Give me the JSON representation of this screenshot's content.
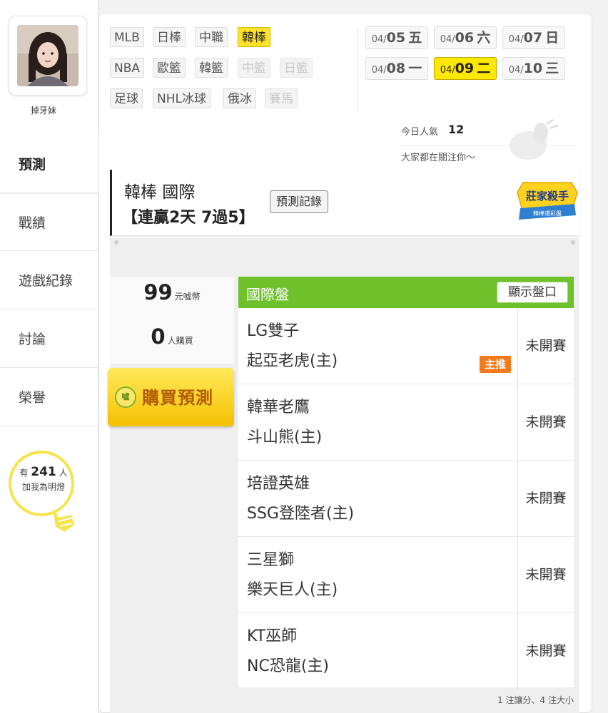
{
  "user": {
    "name": "掉牙妹"
  },
  "sidebar": {
    "items": [
      {
        "label": "預測",
        "active": true
      },
      {
        "label": "戰績"
      },
      {
        "label": "遊戲紀錄"
      },
      {
        "label": "討論"
      },
      {
        "label": "榮譽"
      }
    ],
    "fans": {
      "prefix": "有",
      "count": "241",
      "suffix": "人",
      "caption": "加我為明燈"
    }
  },
  "sports": [
    {
      "label": "MLB"
    },
    {
      "label": "日棒"
    },
    {
      "label": "中職"
    },
    {
      "label": "韓棒",
      "active": true
    },
    {
      "label": "NBA"
    },
    {
      "label": "歐籃"
    },
    {
      "label": "韓籃"
    },
    {
      "label": "中籃",
      "disabled": true
    },
    {
      "label": "日籃",
      "disabled": true
    },
    {
      "label": "足球"
    },
    {
      "label": "NHL冰球"
    },
    {
      "label": "俄冰"
    },
    {
      "label": "賽馬",
      "disabled": true
    }
  ],
  "dates": [
    {
      "month": "04/",
      "day": "05",
      "weekday": "五"
    },
    {
      "month": "04/",
      "day": "06",
      "weekday": "六"
    },
    {
      "month": "04/",
      "day": "07",
      "weekday": "日"
    },
    {
      "month": "04/",
      "day": "08",
      "weekday": "一"
    },
    {
      "month": "04/",
      "day": "09",
      "weekday": "二",
      "active": true
    },
    {
      "month": "04/",
      "day": "10",
      "weekday": "三"
    }
  ],
  "popularity": {
    "label": "今日人氣",
    "value": "12",
    "caption": "大家都在關注你～"
  },
  "title": {
    "league": "韓棒 國際",
    "streak": "【連贏2天 7過5】",
    "record_button": "預測記錄",
    "badge_title": "莊家殺手",
    "badge_sub": "韓棒運彩盤"
  },
  "pricing": {
    "price": "99",
    "price_unit": "元噓幣",
    "buyers": "0",
    "buyers_unit": "人購買",
    "buy_label": "購買預測",
    "coin_label": "噓"
  },
  "games": {
    "header": "國際盤",
    "show_lines": "顯示盤口",
    "main_pick_label": "主推",
    "rows": [
      {
        "away": "LG雙子",
        "home": "起亞老虎(主)",
        "status": "未開賽",
        "main_pick": true
      },
      {
        "away": "韓華老鷹",
        "home": "斗山熊(主)",
        "status": "未開賽"
      },
      {
        "away": "培證英雄",
        "home": "SSG登陸者(主)",
        "status": "未開賽"
      },
      {
        "away": "三星獅",
        "home": "樂天巨人(主)",
        "status": "未開賽"
      },
      {
        "away": "KT巫師",
        "home": "NC恐龍(主)",
        "status": "未開賽"
      }
    ],
    "footnote": "1 注讓分、4 注大小"
  }
}
